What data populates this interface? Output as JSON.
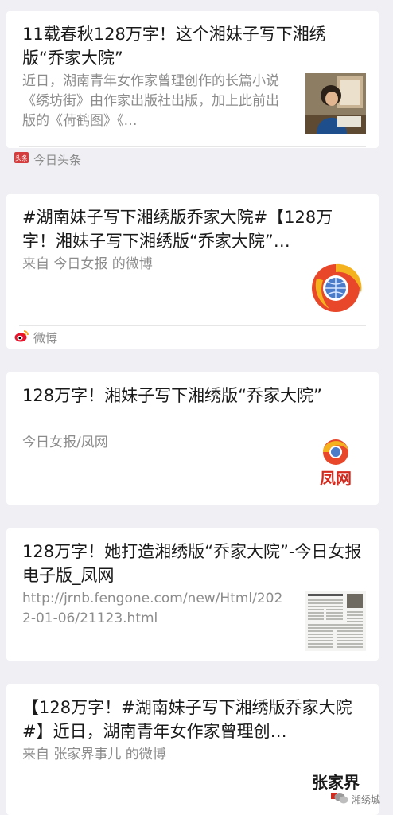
{
  "results": [
    {
      "title": "11载春秋128万字！这个湘妹子写下湘绣版“乔家大院”",
      "desc": "近日，湖南青年女作家曾理创作的长篇小说《绣坊街》由作家出版社出版，加上此前出版的《荷鹤图》《…",
      "source": "今日头条",
      "source_badge": "头条",
      "thumb": "author-photo"
    },
    {
      "title": "#湖南妹子写下湘绣版乔家大院#【128万字！湘妹子写下湘绣版“乔家大院”…",
      "desc": "来自 今日女报 的微博",
      "source": "微博",
      "thumb": "weibo-avatar-logo"
    },
    {
      "title": "128万字！湘妹子写下湘绣版“乔家大院”",
      "desc": "今日女报/凤网",
      "thumb": "fengwang-logo",
      "thumb_text": "凤网"
    },
    {
      "title": "128万字！她打造湘绣版“乔家大院”-今日女报电子版_凤网",
      "desc": "http://jrnb.fengone.com/new/Html/2022-01-06/21123.html",
      "thumb": "newspaper-page"
    },
    {
      "title": "【128万字！#湖南妹子写下湘绣版乔家大院#】近日，湖南青年女作家曾理创…",
      "desc": "来自 张家界事儿 的微博",
      "thumb": "calligraphy-logo",
      "thumb_text": "张家界"
    }
  ],
  "watermark": {
    "text": "湘绣城"
  },
  "colors": {
    "background": "#efeff4",
    "card": "#ffffff",
    "title": "#1a1a1a",
    "meta": "#8c8c8c",
    "toutiao_red": "#d43d3d",
    "weibo_red": "#e6162d",
    "weibo_yellow": "#f5a623"
  }
}
